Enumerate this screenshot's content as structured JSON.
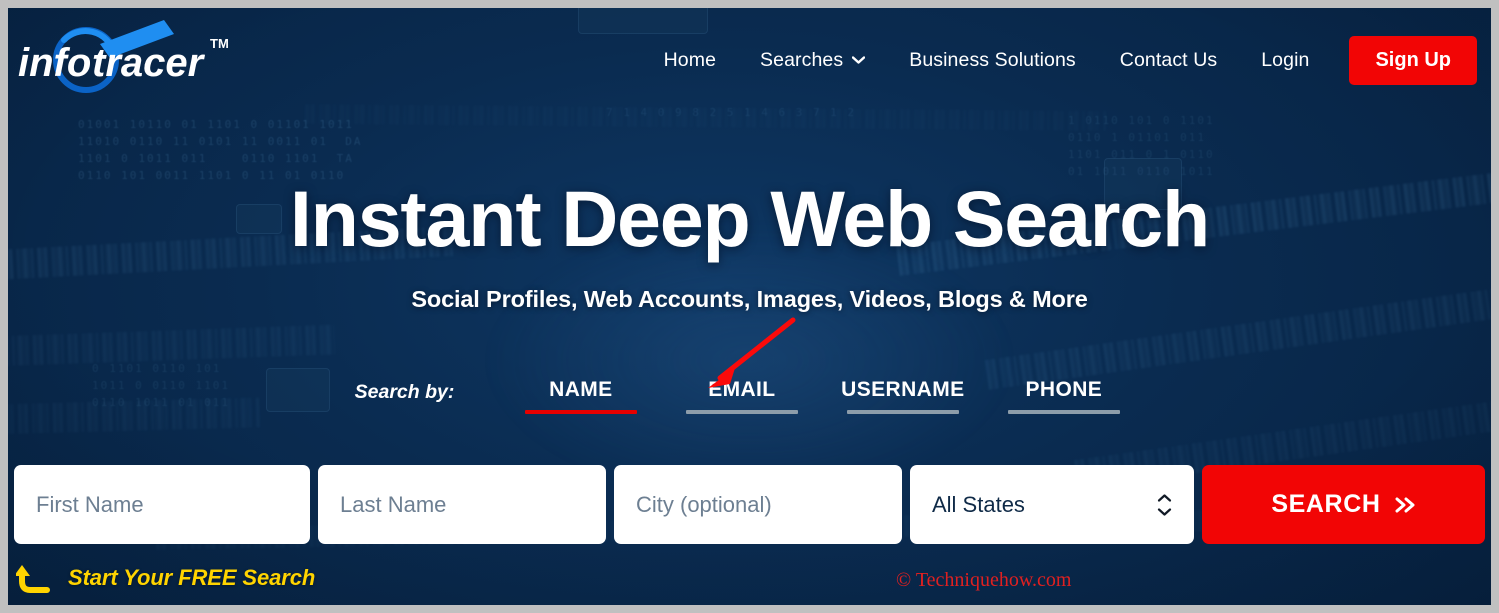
{
  "brand": {
    "logo_text_1": "info",
    "logo_text_2": "tracer",
    "logo_tm": "TM",
    "logo_icon": "magnifier-icon"
  },
  "header": {
    "nav_items": [
      {
        "label": "Home",
        "icon": null
      },
      {
        "label": "Searches",
        "icon": "chevron-down-icon"
      },
      {
        "label": "Business Solutions",
        "icon": null
      },
      {
        "label": "Contact Us",
        "icon": null
      },
      {
        "label": "Login",
        "icon": null
      }
    ],
    "signup_label": "Sign Up",
    "signup_color": "#f20505"
  },
  "hero": {
    "headline": "Instant Deep Web Search",
    "subheadline": "Social Profiles, Web Accounts, Images, Videos, Blogs & More"
  },
  "search_by": {
    "label": "Search by:",
    "tabs": [
      {
        "label": "NAME",
        "active": true,
        "underline_color": "#e60000"
      },
      {
        "label": "EMAIL",
        "active": false,
        "underline_color": "#8d9daa"
      },
      {
        "label": "USERNAME",
        "active": false,
        "underline_color": "#8d9daa"
      },
      {
        "label": "PHONE",
        "active": false,
        "underline_color": "#8d9daa"
      }
    ]
  },
  "form": {
    "first_name_placeholder": "First Name",
    "first_name_value": "",
    "last_name_placeholder": "Last Name",
    "last_name_value": "",
    "city_placeholder": "City (optional)",
    "city_value": "",
    "state_selected": "All States",
    "state_icon": "stepper-updown-icon",
    "search_label": "SEARCH",
    "search_icon": "double-chevron-right-icon",
    "search_color": "#f20505"
  },
  "annotations": {
    "free_search_text": "Start Your FREE Search",
    "free_search_icon": "curved-up-arrow-icon",
    "free_search_color": "#ffd400",
    "pointer_arrow_icon": "red-arrow-icon",
    "pointer_arrow_color": "#fb0a0a",
    "pointer_arrow_target": "EMAIL",
    "watermark": "© Techniquehow.com",
    "watermark_color": "#e02020"
  },
  "theme": {
    "background_navy": "#0b2d51",
    "accent_red": "#f20505",
    "text_white": "#ffffff"
  }
}
